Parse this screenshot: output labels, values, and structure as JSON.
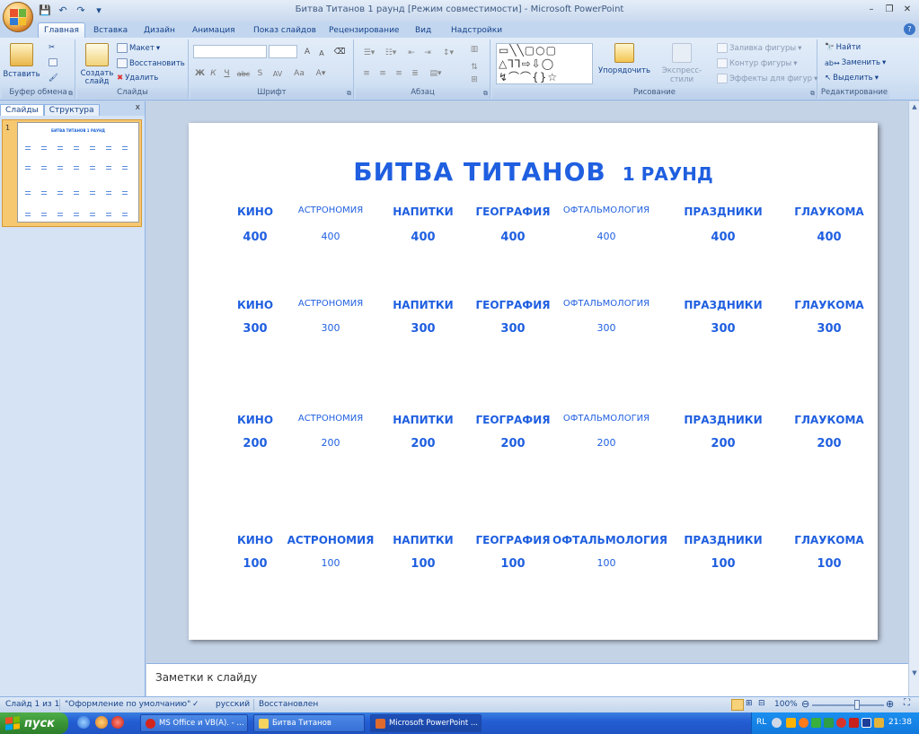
{
  "window": {
    "title": "Битва Титанов 1 раунд [Режим совместимости] - Microsoft PowerPoint",
    "controls": {
      "minimize": "–",
      "restore": "❐",
      "close": "✕"
    }
  },
  "qat": {
    "save": "💾",
    "undo": "↶",
    "redo": "↷",
    "more": "▾"
  },
  "tabs": [
    "Главная",
    "Вставка",
    "Дизайн",
    "Анимация",
    "Показ слайдов",
    "Рецензирование",
    "Вид",
    "Надстройки"
  ],
  "ribbon": {
    "clipboard": {
      "label": "Буфер обмена",
      "paste": "Вставить"
    },
    "slides": {
      "label": "Слайды",
      "new_slide": "Создать слайд",
      "layout": "Макет",
      "reset": "Восстановить",
      "delete": "Удалить"
    },
    "font": {
      "label": "Шрифт",
      "bold": "Ж",
      "italic": "К",
      "underline": "Ч",
      "strike": "abc",
      "shadow": "S",
      "spacing": "AV",
      "case": "Aa",
      "grow": "A",
      "shrink": "A"
    },
    "paragraph": {
      "label": "Абзац"
    },
    "drawing": {
      "label": "Рисование",
      "arrange": "Упорядочить",
      "quick_styles": "Экспресс-стили",
      "fill": "Заливка фигуры",
      "outline": "Контур фигуры",
      "effects": "Эффекты для фигур"
    },
    "editing": {
      "label": "Редактирование",
      "find": "Найти",
      "replace": "Заменить",
      "select": "Выделить"
    }
  },
  "left_pane": {
    "tab_slides": "Слайды",
    "tab_outline": "Структура",
    "close": "x",
    "thumb_num": "1",
    "thumb_title": "БИТВА ТИТАНОВ    1 РАУНД"
  },
  "slide": {
    "title": "БИТВА ТИТАНОВ",
    "round": "1 РАУНД",
    "rows": [
      {
        "cats": [
          "КИНО",
          "АСТРОНОМИЯ",
          "НАПИТКИ",
          "ГЕОГРАФИЯ",
          "ОФТАЛЬМОЛОГИЯ",
          "ПРАЗДНИКИ",
          "ГЛАУКОМА"
        ],
        "vals": [
          "400",
          "400",
          "400",
          "400",
          "400",
          "400",
          "400"
        ]
      },
      {
        "cats": [
          "КИНО",
          "АСТРОНОМИЯ",
          "НАПИТКИ",
          "ГЕОГРАФИЯ",
          "ОФТАЛЬМОЛОГИЯ",
          "ПРАЗДНИКИ",
          "ГЛАУКОМА"
        ],
        "vals": [
          "300",
          "300",
          "300",
          "300",
          "300",
          "300",
          "300"
        ]
      },
      {
        "cats": [
          "КИНО",
          "АСТРОНОМИЯ",
          "НАПИТКИ",
          "ГЕОГРАФИЯ",
          "ОФТАЛЬМОЛОГИЯ",
          "ПРАЗДНИКИ",
          "ГЛАУКОМА"
        ],
        "vals": [
          "200",
          "200",
          "200",
          "200",
          "200",
          "200",
          "200"
        ]
      },
      {
        "cats": [
          "КИНО",
          "АСТРОНОМИЯ",
          "НАПИТКИ",
          "ГЕОГРАФИЯ",
          "ОФТАЛЬМОЛОГИЯ",
          "ПРАЗДНИКИ",
          "ГЛАУКОМА"
        ],
        "vals": [
          "100",
          "100",
          "100",
          "100",
          "100",
          "100",
          "100"
        ]
      }
    ]
  },
  "notes": {
    "placeholder": "Заметки к слайду"
  },
  "status": {
    "slide": "Слайд 1 из 1",
    "theme": "\"Оформление по умолчанию\"",
    "lang": "русский",
    "state": "Восстановлен",
    "zoom": "100%",
    "zoom_fraction": 0.62
  },
  "taskbar": {
    "start": "пуск",
    "tasks": [
      "MS Office и VB(A). - ...",
      "Битва Титанов",
      "Microsoft PowerPoint ..."
    ],
    "lang": "RL",
    "clock": "21:38"
  },
  "colors": {
    "slide_text": "#1f5fe0",
    "ribbon_text": "#15428b",
    "taskbar": "#245ed4",
    "start": "#3a9436"
  }
}
